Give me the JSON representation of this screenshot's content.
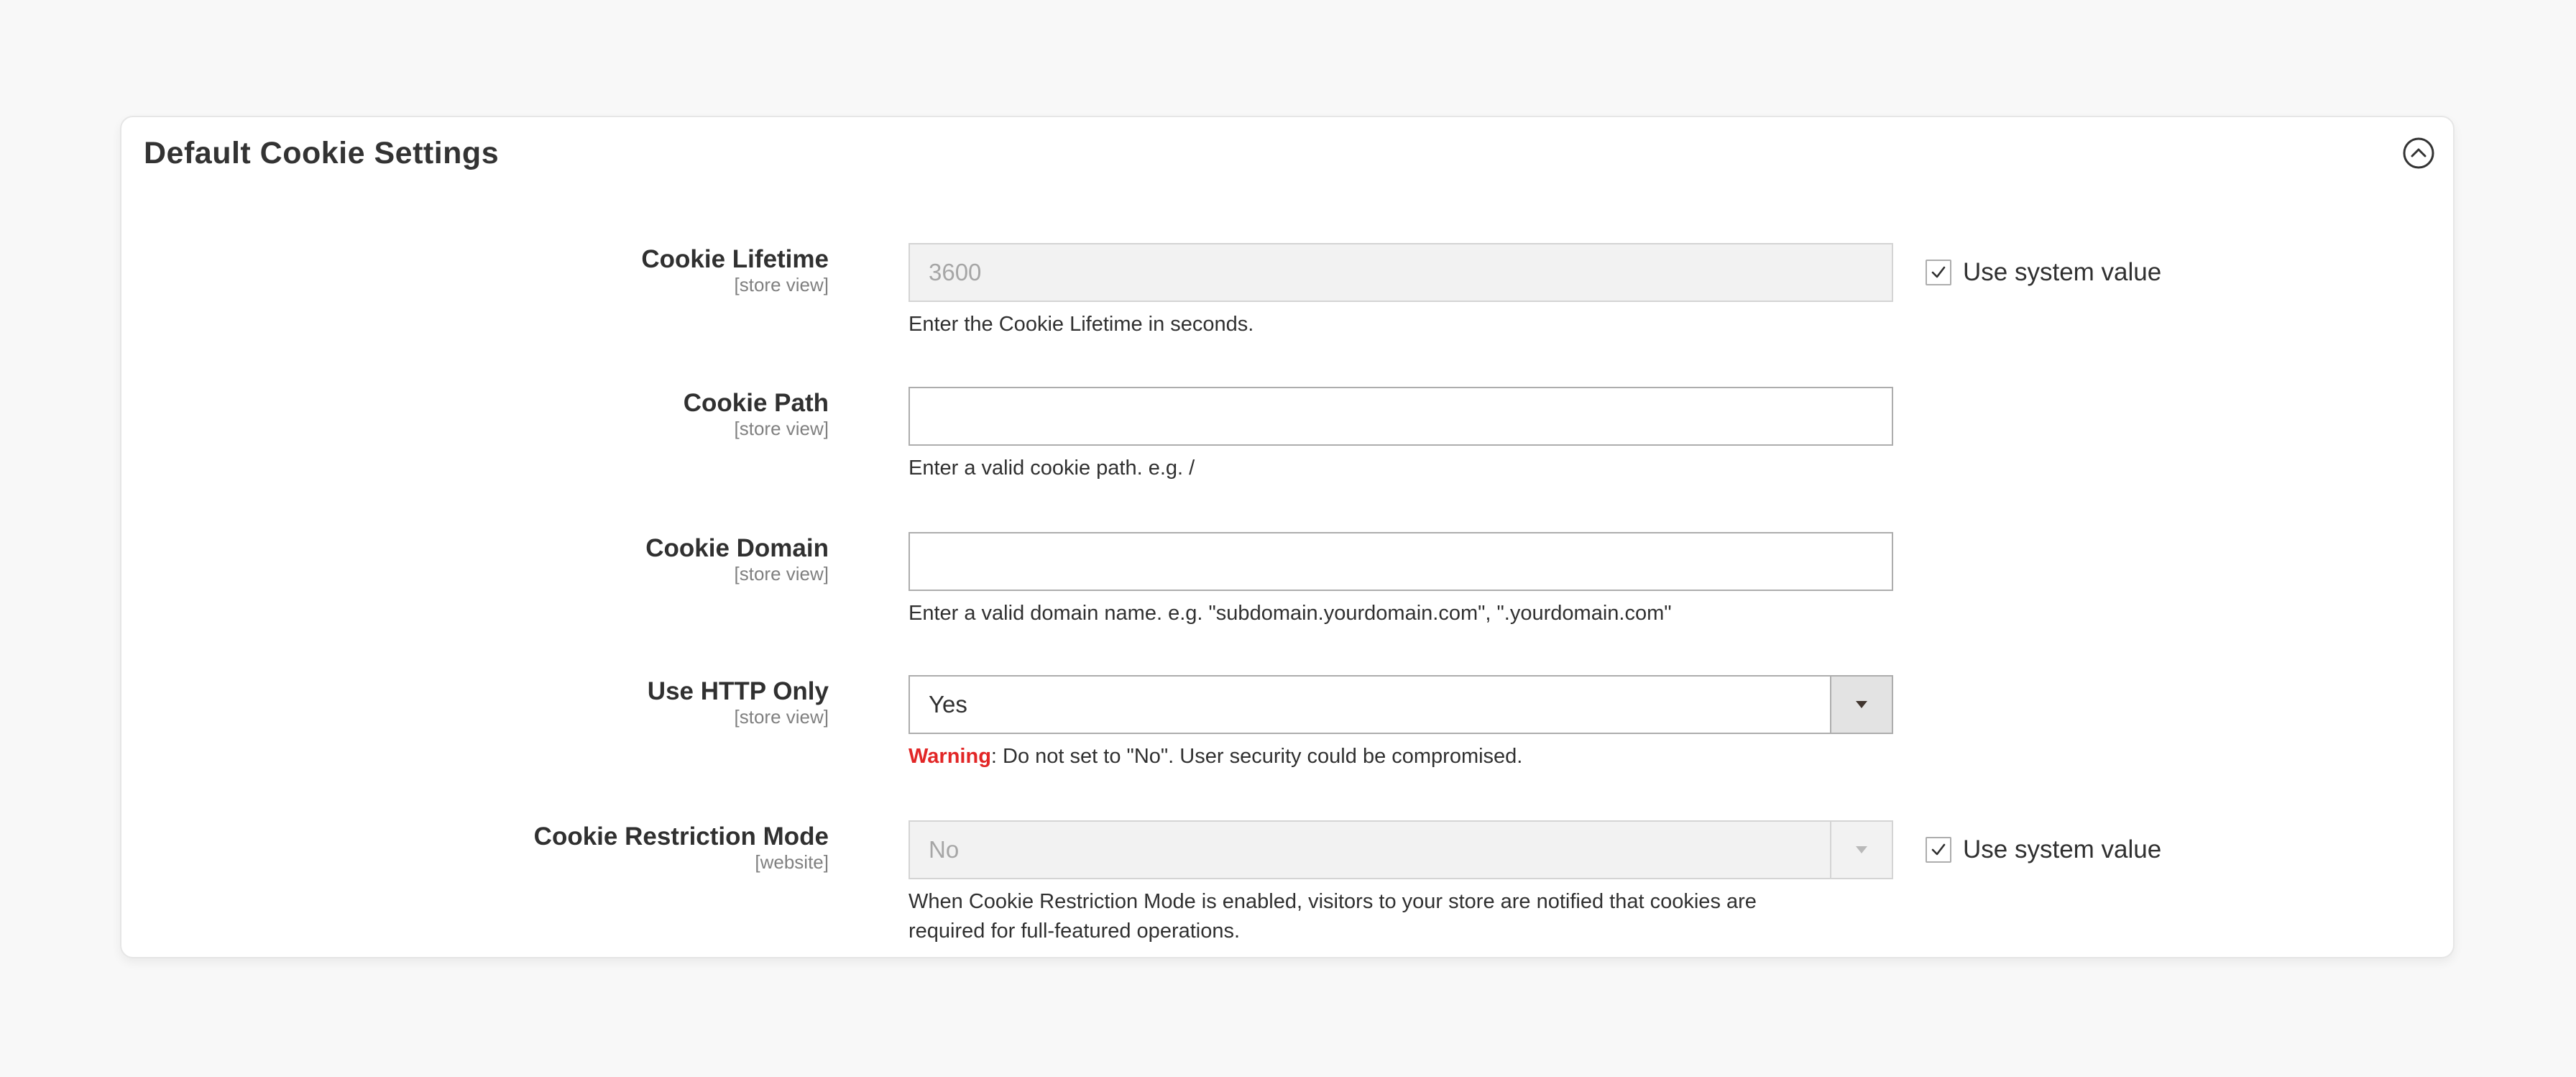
{
  "panel": {
    "title": "Default Cookie Settings",
    "collapse_icon": "circle-chevron-up-icon"
  },
  "fields": {
    "cookie_lifetime": {
      "label": "Cookie Lifetime",
      "scope": "[store view]",
      "value": "3600",
      "note": "Enter the Cookie Lifetime in seconds.",
      "use_system_value": true,
      "use_system_value_label": "Use system value"
    },
    "cookie_path": {
      "label": "Cookie Path",
      "scope": "[store view]",
      "value": "",
      "note": "Enter a valid cookie path. e.g. /"
    },
    "cookie_domain": {
      "label": "Cookie Domain",
      "scope": "[store view]",
      "value": "",
      "note": "Enter a valid domain name. e.g. \"subdomain.yourdomain.com\", \".yourdomain.com\""
    },
    "use_http_only": {
      "label": "Use HTTP Only",
      "scope": "[store view]",
      "value": "Yes",
      "note_warning": "Warning",
      "note_rest": ": Do not set to \"No\". User security could be compromised."
    },
    "cookie_restriction_mode": {
      "label": "Cookie Restriction Mode",
      "scope": "[website]",
      "value": "No",
      "note_line1": "When Cookie Restriction Mode is enabled, visitors to your store are notified that cookies are",
      "note_line2": "required for full-featured operations.",
      "use_system_value": true,
      "use_system_value_label": "Use system value"
    }
  },
  "colors": {
    "warning": "#e22626",
    "page_background": "#f8f8f8",
    "panel_background": "#ffffff",
    "disabled_field": "#f2f2f2"
  }
}
